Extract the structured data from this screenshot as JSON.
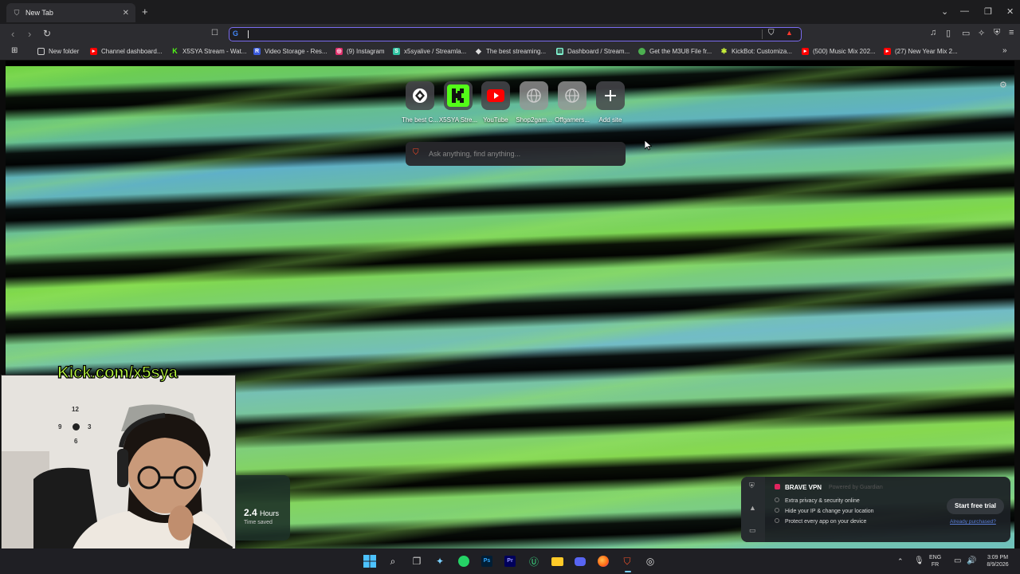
{
  "tab": {
    "title": "New Tab",
    "close": "✕",
    "new": "+"
  },
  "window": {
    "chevron": "⌄",
    "minimize": "—",
    "restore": "❐",
    "close": "✕"
  },
  "nav": {
    "back": "‹",
    "forward": "›",
    "reload": "↻",
    "bookmark": "🔖"
  },
  "omnibox": {
    "value": "",
    "engine": "G"
  },
  "bookmarks": [
    {
      "label": "New folder",
      "icon": "folder-icon",
      "color": "#cfcfcf"
    },
    {
      "label": "Channel dashboard...",
      "icon": "youtube-icon",
      "color": "#ff0000"
    },
    {
      "label": "X5SYA Stream - Wat...",
      "icon": "kick-icon",
      "color": "#53fc18"
    },
    {
      "label": "Video Storage - Res...",
      "icon": "r-icon",
      "color": "#3b5bdb"
    },
    {
      "label": "(9) Instagram",
      "icon": "instagram-icon",
      "color": "#e1306c"
    },
    {
      "label": "x5syalive / Streamla...",
      "icon": "streamlabs-icon",
      "color": "#31c3a2"
    },
    {
      "label": "The best streaming...",
      "icon": "diamond-icon",
      "color": "#bbbbbb"
    },
    {
      "label": "Dashboard / Stream...",
      "icon": "dashboard-icon",
      "color": "#80f5d2"
    },
    {
      "label": "Get the M3U8 File fr...",
      "icon": "green-dot-icon",
      "color": "#4caf50"
    },
    {
      "label": "KickBot: Customiza...",
      "icon": "kickbot-icon",
      "color": "#c8f03a"
    },
    {
      "label": "(500) Music Mix 202...",
      "icon": "youtube-icon",
      "color": "#ff0000"
    },
    {
      "label": "(27) New Year Mix 2...",
      "icon": "youtube-icon",
      "color": "#ff0000"
    }
  ],
  "top_sites": [
    {
      "label": "The best C...",
      "icon": "diamond-icon"
    },
    {
      "label": "X5SYA Stre...",
      "icon": "kick-icon"
    },
    {
      "label": "YouTube",
      "icon": "youtube-icon"
    },
    {
      "label": "Shop2gam...",
      "icon": "globe-icon"
    },
    {
      "label": "Offgamers...",
      "icon": "globe-icon"
    },
    {
      "label": "Add site",
      "icon": "plus-icon"
    }
  ],
  "search": {
    "placeholder": "Ask anything, find anything..."
  },
  "stats": {
    "value": "2.4",
    "unit": "Hours",
    "label": "Time saved"
  },
  "vpn": {
    "title": "BRAVE VPN",
    "powered": "Powered by Guardian",
    "features": [
      "Extra privacy & security online",
      "Hide your IP & change your location",
      "Protect every app on your device"
    ],
    "cta": "Start free trial",
    "already": "Already purchased?"
  },
  "overlay": {
    "kick_text": "Kick.com/x5sya"
  },
  "clock_face": {
    "n12": "12",
    "n3": "3",
    "n6": "6",
    "n9": "9"
  },
  "tray": {
    "lang1": "ENG",
    "lang2": "FR",
    "time": "3:09 PM",
    "date": "8/9/2026"
  }
}
